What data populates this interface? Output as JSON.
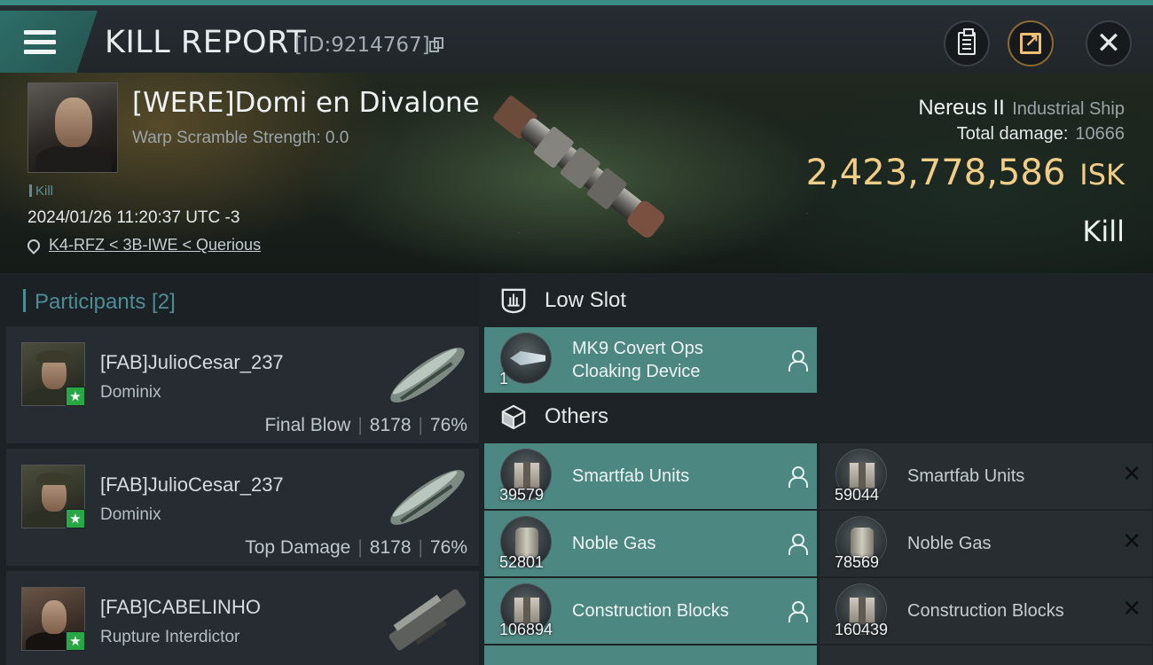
{
  "header": {
    "title": "KILL REPORT",
    "report_id": "[ID:9214767]"
  },
  "victim": {
    "name": "[WERE]Domi en Divalone",
    "warp_scramble": "Warp Scramble Strength: 0.0",
    "kill_tag": "Kill",
    "timestamp": "2024/01/26 11:20:37 UTC -3",
    "location": "K4-RFZ < 3B-IWE < Querious",
    "ship_name": "Nereus II",
    "ship_class": "Industrial Ship",
    "total_damage_label": "Total damage:",
    "total_damage": "10666",
    "isk_value": "2,423,778,586",
    "isk_unit": "ISK",
    "result": "Kill"
  },
  "participants": {
    "header": "Participants [2]",
    "items": [
      {
        "name": "[FAB]JulioCesar_237",
        "ship": "Dominix",
        "role": "Final Blow",
        "damage": "8178",
        "percent": "76%"
      },
      {
        "name": "[FAB]JulioCesar_237",
        "ship": "Dominix",
        "role": "Top Damage",
        "damage": "8178",
        "percent": "76%"
      },
      {
        "name": "[FAB]CABELINHO",
        "ship": "Rupture Interdictor"
      }
    ]
  },
  "modules": {
    "low_slot_header": "Low Slot",
    "others_header": "Others",
    "low_slot": [
      {
        "qty": "1",
        "name_line1": "MK9 Covert Ops",
        "name_line2": "Cloaking Device",
        "status": "dropped"
      }
    ],
    "others": [
      {
        "qty": "39579",
        "name": "Smartfab Units",
        "status": "dropped"
      },
      {
        "qty": "59044",
        "name": "Smartfab Units",
        "status": "destroyed"
      },
      {
        "qty": "52801",
        "name": "Noble Gas",
        "status": "dropped"
      },
      {
        "qty": "78569",
        "name": "Noble Gas",
        "status": "destroyed"
      },
      {
        "qty": "106894",
        "name": "Construction Blocks",
        "status": "dropped"
      },
      {
        "qty": "160439",
        "name": "Construction Blocks",
        "status": "destroyed"
      }
    ]
  },
  "colors": {
    "accent_teal": "#3b8c84",
    "dropped_bg": "#4d8782",
    "isk_gold": "#f2cd85",
    "participant_star": "#28a745"
  }
}
